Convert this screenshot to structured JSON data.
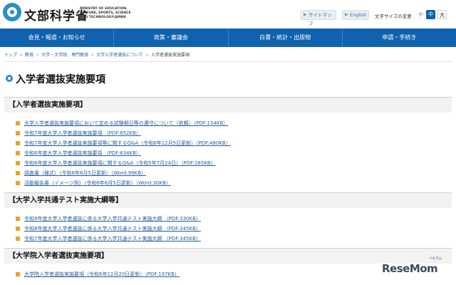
{
  "header": {
    "logo_text": "文部科学省",
    "logo_en": "MINISTRY OF EDUCATION, CULTURE, SPORTS, SCIENCE AND TECHNOLOGY-JAPAN",
    "sitemap_label": "サイトマップ",
    "english_label": "English",
    "fontsize_label": "文字サイズの変更",
    "fontsize_small": "小",
    "fontsize_mid": "中",
    "fontsize_large": "大"
  },
  "nav": {
    "items": [
      {
        "label": "会見・報道・お知らせ"
      },
      {
        "label": "政策・審議会"
      },
      {
        "label": "白書・統計・出版物"
      },
      {
        "label": "申請・手続き"
      }
    ]
  },
  "breadcrumb": {
    "items": [
      "トップ",
      "教育",
      "大学・大学院、専門教育",
      "大学入学者選抜について",
      "入学者選抜実施要項"
    ]
  },
  "page": {
    "title": "入学者選抜実施要項"
  },
  "sections": [
    {
      "heading": "【入学者選抜実施要項】",
      "links": [
        "大学入学者選抜実施要項において定める試験期日等の遵守について（依頼）（PDF:154KB）",
        "令和7年度大学入学者選抜実施要項 （PDF:652KB）",
        "令和7年度大学入学者選抜実施要項等に関するQ&A（令和6年12月5日更新）（PDF:480KB）",
        "令和6年度大学入学者選抜実施要項 （PDF:634KB）",
        "令和6年度大学入学者選抜実施要項に関するQ&A（令和5年7月24日）（PDF:285KB）",
        "調査書（様式）（令和6年6月5日更新）（Word:99KB）",
        "活動報告書（イメージ例）（令和6年6月5日更新）（Word:30KB）"
      ]
    },
    {
      "heading": "【大学入学共通テスト実施大綱等】",
      "links": [
        "令和9年度大学入学者選抜に係る大学入学共通テスト実施大綱 （PDF:330KB）",
        "令和8年度大学入学者選抜に係る大学入学共通テスト実施大綱 （PDF:345KB）",
        "令和7年度大学入学者選抜に係る大学入学共通テスト実施大綱 （PDF:345KB）"
      ]
    },
    {
      "heading": "【大学院入学者選抜実施要項】",
      "links": [
        "大学院入学者選抜実施要項（令和6年12月20日更新）（PDF:197KB）"
      ]
    }
  ],
  "watermark": {
    "text": "ReseMom",
    "small": "リセマム"
  }
}
